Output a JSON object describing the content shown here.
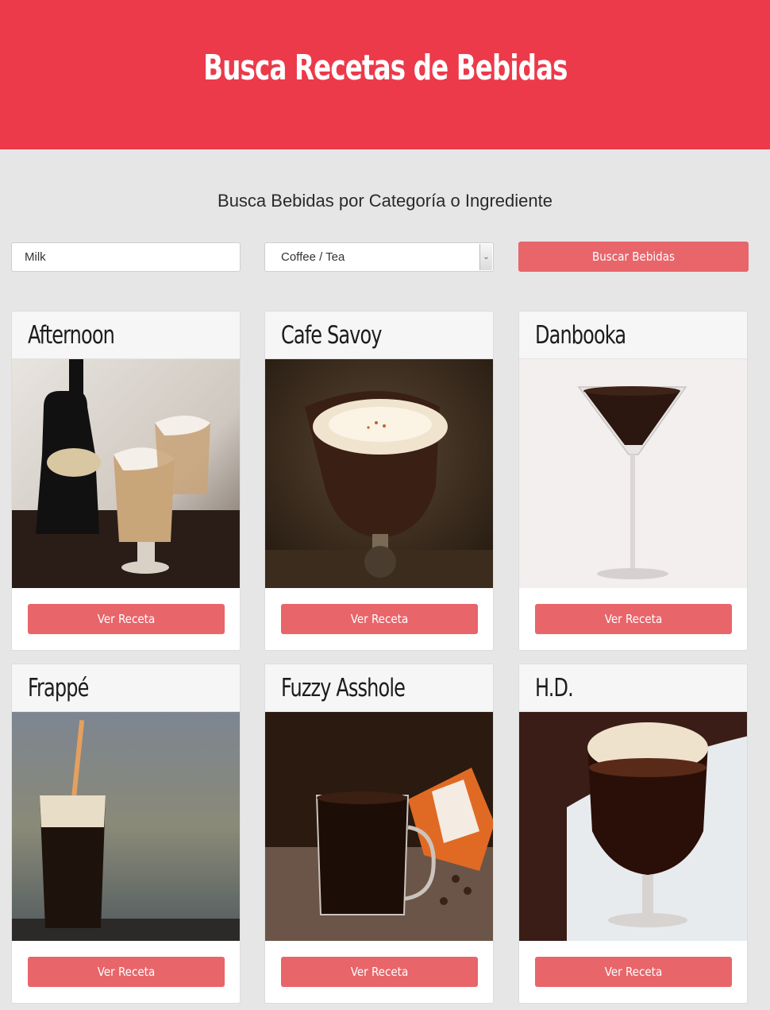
{
  "header": {
    "title": "Busca Recetas de Bebidas"
  },
  "search": {
    "subtitle": "Busca Bebidas por Categoría o Ingrediente",
    "ingredient_value": "Milk",
    "category_value": "Coffee / Tea",
    "submit_label": "Buscar Bebidas"
  },
  "cards": [
    {
      "title": "Afternoon",
      "button_label": "Ver Receta"
    },
    {
      "title": "Cafe Savoy",
      "button_label": "Ver Receta"
    },
    {
      "title": "Danbooka",
      "button_label": "Ver Receta"
    },
    {
      "title": "Frappé",
      "button_label": "Ver Receta"
    },
    {
      "title": "Fuzzy Asshole",
      "button_label": "Ver Receta"
    },
    {
      "title": "H.D.",
      "button_label": "Ver Receta"
    }
  ],
  "colors": {
    "brand": "#ec3a4b",
    "button": "#e8656a",
    "background": "#e6e6e6"
  }
}
